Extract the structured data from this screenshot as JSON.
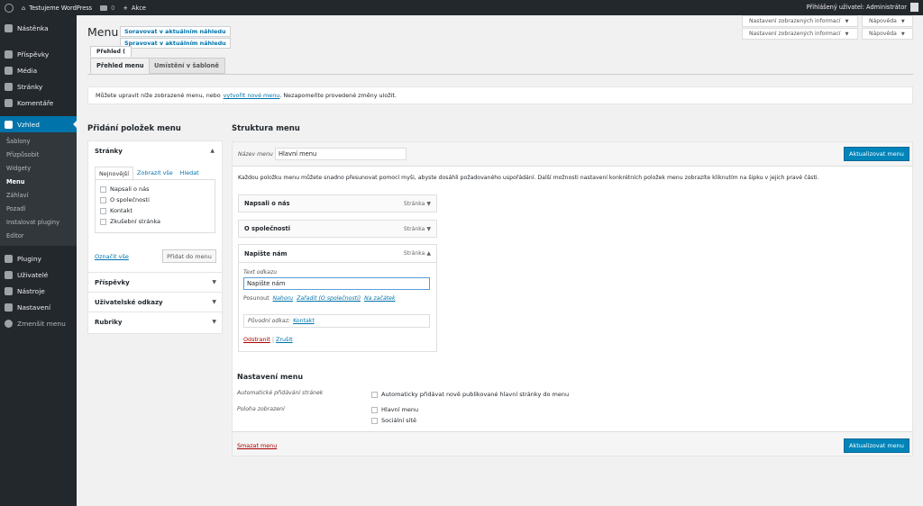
{
  "adminbar": {
    "site_name": "Testujeme WordPress",
    "comments_count": "0",
    "new_label": "Akce",
    "greeting": "Přihlášený uživatel: Administrátor"
  },
  "sidebar": {
    "items": [
      {
        "label": "Nástěnka",
        "icon": "dashboard-icon"
      },
      {
        "label": "Příspěvky",
        "icon": "pin-icon"
      },
      {
        "label": "Média",
        "icon": "media-icon"
      },
      {
        "label": "Stránky",
        "icon": "pages-icon"
      },
      {
        "label": "Komentáře",
        "icon": "comment-icon"
      },
      {
        "label": "Vzhled",
        "icon": "brush-icon"
      }
    ],
    "submenu": [
      "Šablony",
      "Přizpůsobit",
      "Widgety",
      "Menu",
      "Záhlaví",
      "Pozadí",
      "Instalovat pluginy",
      "Editor"
    ],
    "items2": [
      {
        "label": "Pluginy",
        "icon": "plugin-icon"
      },
      {
        "label": "Uživatelé",
        "icon": "users-icon"
      },
      {
        "label": "Nástroje",
        "icon": "tools-icon"
      },
      {
        "label": "Nastavení",
        "icon": "settings-icon"
      },
      {
        "label": "Zmenšit menu",
        "icon": "collapse-icon"
      }
    ]
  },
  "screen_options": "Nastavení zobrazených informací",
  "help": "Nápověda",
  "page_title": "Menu",
  "tooltip1": "Soravovat v aktuálním náhledu",
  "tooltip2": "Spravovat v aktuálním náhledu",
  "tabs": {
    "overlap": "Přehled (",
    "overview": "Přehled menu",
    "locations": "Umístění v šabloně"
  },
  "notice": {
    "before": "Můžete upravit níže zobrazené menu, nebo",
    "link": "vytvořit nové menu",
    "after": ". Nezapomeňte provedené změny uložit."
  },
  "left": {
    "heading": "Přidání položek menu",
    "pages": {
      "title": "Stránky",
      "tabs": [
        "Nejnovější",
        "Zobrazit vše",
        "Hledat"
      ],
      "items": [
        "Napsali o nás",
        "O společnosti",
        "Kontakt",
        "Zkušební stránka"
      ],
      "select_all": "Označit vše",
      "add_button": "Přidat do menu"
    },
    "sections": [
      "Příspěvky",
      "Uživatelské odkazy",
      "Rubriky"
    ]
  },
  "right": {
    "heading": "Struktura menu",
    "name_label": "Název menu",
    "name_value": "Hlavní menu",
    "save_button": "Aktualizovat menu",
    "instructions": "Každou položku menu můžete snadno přesunovat pomocí myši, abyste dosáhli požadovaného uspořádání. Další možnosti nastavení konkrétních položek menu zobrazíte kliknutím na šipku v jejich pravé části.",
    "items": [
      {
        "title": "Napsali o nás",
        "type": "Stránka"
      },
      {
        "title": "O společnosti",
        "type": "Stránka"
      },
      {
        "title": "Napište nám",
        "type": "Stránka"
      }
    ],
    "edit": {
      "link_text_label": "Text odkazu",
      "link_text_value": "Napište nám",
      "move_label": "Posunout",
      "move_up": "Nahoru",
      "move_under": "Zařadit (O společnosti)",
      "move_top": "Na začátek",
      "original_label": "Původní odkaz:",
      "original_link": "Kontakt",
      "remove": "Odstranit",
      "separator": "|",
      "cancel": "Zrušit"
    },
    "settings": {
      "heading": "Nastavení menu",
      "auto_label": "Automatické přidávání stránek",
      "auto_option": "Automaticky přidávat nově publikované hlavní stránky do menu",
      "location_label": "Poloha zobrazení",
      "locations": [
        "Hlavní menu",
        "Sociální sítě"
      ]
    },
    "delete": "Smazat menu"
  }
}
